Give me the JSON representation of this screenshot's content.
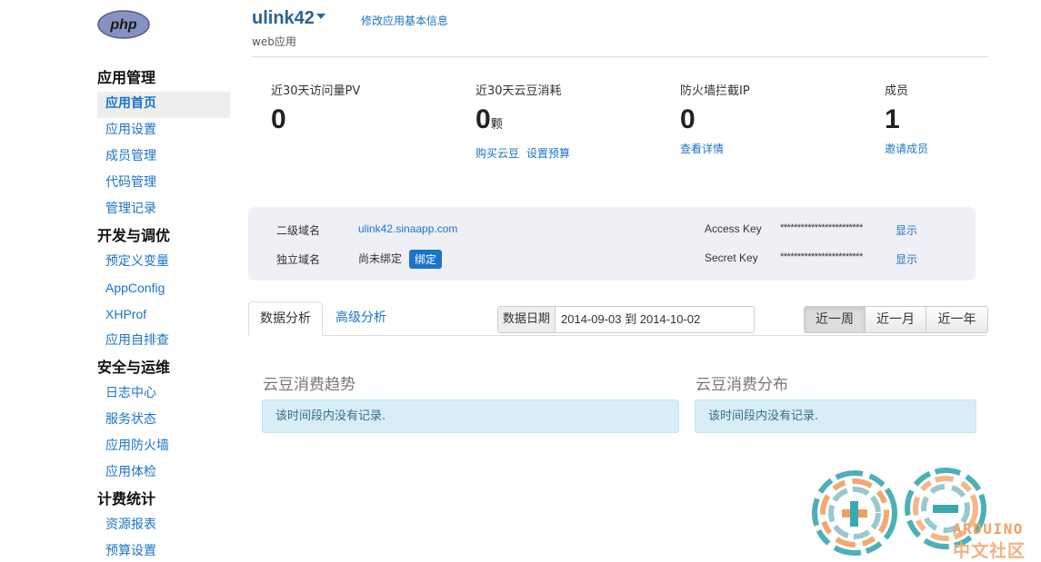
{
  "logo": {
    "text": "php"
  },
  "header": {
    "app_name": "ulink42",
    "app_type": "web应用",
    "edit_link": "修改应用基本信息"
  },
  "sidebar": {
    "groups": [
      {
        "title": "应用管理",
        "items": [
          "应用首页",
          "应用设置",
          "成员管理",
          "代码管理",
          "管理记录"
        ]
      },
      {
        "title": "开发与调优",
        "items": [
          "预定义变量",
          "AppConfig",
          "XHProf",
          "应用自排查"
        ]
      },
      {
        "title": "安全与运维",
        "items": [
          "日志中心",
          "服务状态",
          "应用防火墙",
          "应用体检"
        ]
      },
      {
        "title": "计费统计",
        "items": [
          "资源报表",
          "预算设置"
        ]
      }
    ],
    "active_item": "应用首页"
  },
  "stats": [
    {
      "label": "近30天访问量PV",
      "value": "0",
      "unit": "",
      "links": []
    },
    {
      "label": "近30天云豆消耗",
      "value": "0",
      "unit": "颗",
      "links": [
        "购买云豆",
        "设置预算"
      ]
    },
    {
      "label": "防火墙拦截IP",
      "value": "0",
      "unit": "",
      "links": [
        "查看详情"
      ]
    },
    {
      "label": "成员",
      "value": "1",
      "unit": "",
      "links": [
        "邀请成员"
      ]
    }
  ],
  "domain": {
    "subdomain_label": "二级域名",
    "subdomain_value": "ulink42.sinaapp.com",
    "custom_label": "独立域名",
    "custom_value": "尚未绑定",
    "bind_button": "绑定",
    "access_key_label": "Access Key",
    "access_key_value": "************************",
    "access_key_show": "显示",
    "secret_key_label": "Secret Key",
    "secret_key_value": "************************",
    "secret_key_show": "显示"
  },
  "tabs": {
    "items": [
      "数据分析",
      "高级分析"
    ],
    "active": "数据分析"
  },
  "date_filter": {
    "label": "数据日期",
    "value": "2014-09-03 到 2014-10-02"
  },
  "range_buttons": {
    "items": [
      "近一周",
      "近一月",
      "近一年"
    ],
    "active": "近一周"
  },
  "panels": [
    {
      "title": "云豆消费趋势",
      "message": "该时间段内没有记录."
    },
    {
      "title": "云豆消费分布",
      "message": "该时间段内没有记录."
    }
  ],
  "watermark": {
    "line1": "ARDUINO",
    "line2": "中文社区"
  },
  "colors": {
    "link": "#1a74c9",
    "alert_bg": "#d9edf7",
    "alert_text": "#31708f",
    "watermark_orange": "#f0a060",
    "watermark_teal": "#3aa8b0"
  }
}
